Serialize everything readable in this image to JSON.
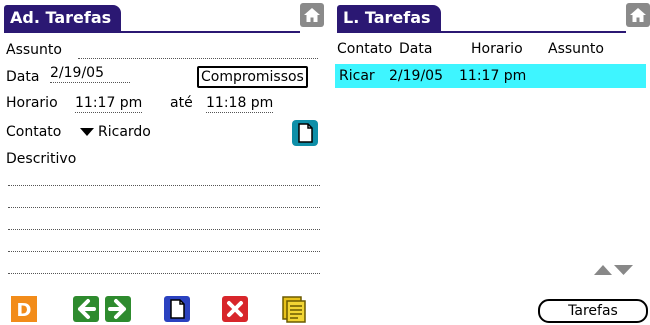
{
  "left": {
    "title": "Ad. Tarefas",
    "assunto_label": "Assunto",
    "assunto_value": "",
    "data_label": "Data",
    "data_value": "2/19/05",
    "compromissos_label": "Compromissos",
    "horario_label": "Horario",
    "horario_start": "11:17 pm",
    "ate_label": "até",
    "horario_end": "11:18 pm",
    "contato_label": "Contato",
    "contato_value": "Ricardo",
    "descritivo_label": "Descritivo",
    "toolbar_icons": [
      "document-orange-icon",
      "arrow-left-icon",
      "arrow-right-icon",
      "new-document-icon",
      "delete-icon",
      "notes-icon"
    ]
  },
  "right": {
    "title": "L. Tarefas",
    "columns": [
      "Contato",
      "Data",
      "Horario",
      "Assunto"
    ],
    "rows": [
      {
        "contato": "Ricar",
        "data": "2/19/05",
        "horario": "11:17 pm",
        "assunto": ""
      }
    ],
    "tarefas_button": "Tarefas"
  },
  "colors": {
    "tab_bg": "#2b1873",
    "highlight": "#3ef5ff"
  }
}
